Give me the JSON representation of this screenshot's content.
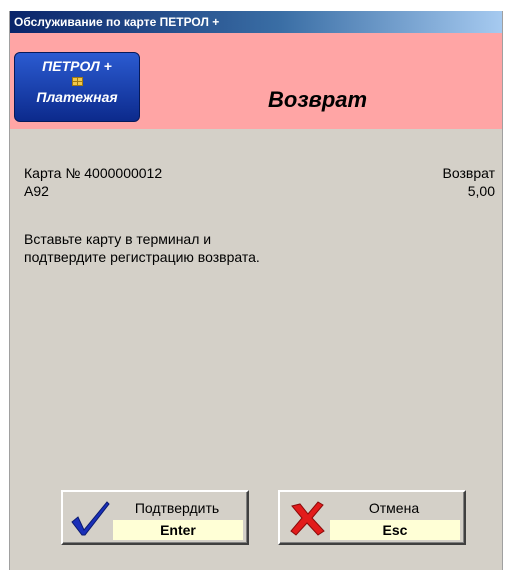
{
  "window": {
    "title": "Обслуживание по карте ПЕТРОЛ +"
  },
  "header": {
    "logo": {
      "line1": "ПЕТРОЛ +",
      "line2": "Платежная",
      "icon": "chip-icon"
    },
    "title": "Возврат",
    "background": "#ffa5a5"
  },
  "info": {
    "card_label": "Карта № 4000000012",
    "code": "А92",
    "operation": "Возврат",
    "amount": "5,00"
  },
  "message": {
    "line1": "Вставьте карту в терминал и",
    "line2": "подтвердите регистрацию возврата."
  },
  "buttons": {
    "confirm": {
      "label": "Подтвердить",
      "key": "Enter",
      "icon": "checkmark-icon"
    },
    "cancel": {
      "label": "Отмена",
      "key": "Esc",
      "icon": "cross-icon"
    }
  }
}
